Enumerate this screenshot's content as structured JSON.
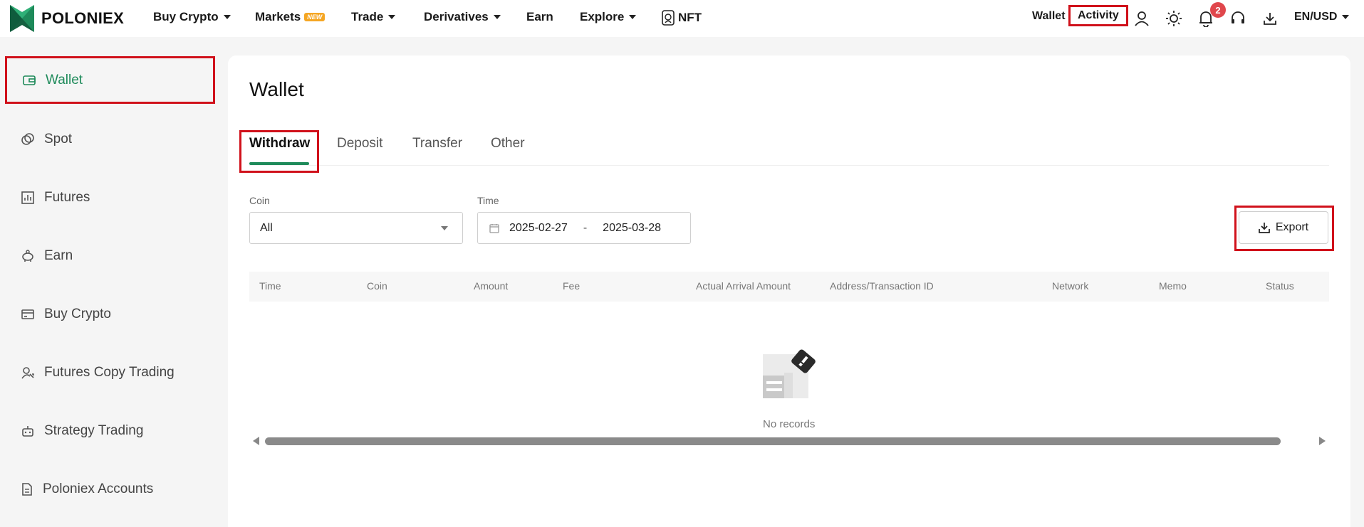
{
  "brand": {
    "name": "POLONIEX",
    "green": "#1e8a5a",
    "highlight": "#d0111b"
  },
  "nav": {
    "buy_crypto": "Buy Crypto",
    "markets": "Markets",
    "markets_badge": "NEW",
    "trade": "Trade",
    "derivatives": "Derivatives",
    "earn": "Earn",
    "explore": "Explore",
    "nft": "NFT",
    "wallet": "Wallet",
    "activity": "Activity",
    "notifications_count": "2",
    "locale": "EN/USD"
  },
  "sidebar": {
    "items": [
      {
        "label": "Wallet",
        "icon": "wallet-icon",
        "active": true
      },
      {
        "label": "Spot",
        "icon": "spot-icon"
      },
      {
        "label": "Futures",
        "icon": "futures-icon"
      },
      {
        "label": "Earn",
        "icon": "piggy-bank-icon"
      },
      {
        "label": "Buy Crypto",
        "icon": "card-icon"
      },
      {
        "label": "Futures Copy Trading",
        "icon": "copy-trading-icon"
      },
      {
        "label": "Strategy Trading",
        "icon": "bot-icon"
      },
      {
        "label": "Poloniex Accounts",
        "icon": "document-icon"
      }
    ]
  },
  "main": {
    "title": "Wallet",
    "tabs": [
      "Withdraw",
      "Deposit",
      "Transfer",
      "Other"
    ],
    "active_tab": "Withdraw",
    "filters": {
      "coin_label": "Coin",
      "coin_value": "All",
      "time_label": "Time",
      "date_from": "2025-02-27",
      "date_sep": "-",
      "date_to": "2025-03-28"
    },
    "export_label": "Export",
    "table": {
      "columns": [
        "Time",
        "Coin",
        "Amount",
        "Fee",
        "Actual Arrival Amount",
        "Address/Transaction ID",
        "Network",
        "Memo",
        "Status"
      ],
      "empty_text": "No records"
    }
  }
}
